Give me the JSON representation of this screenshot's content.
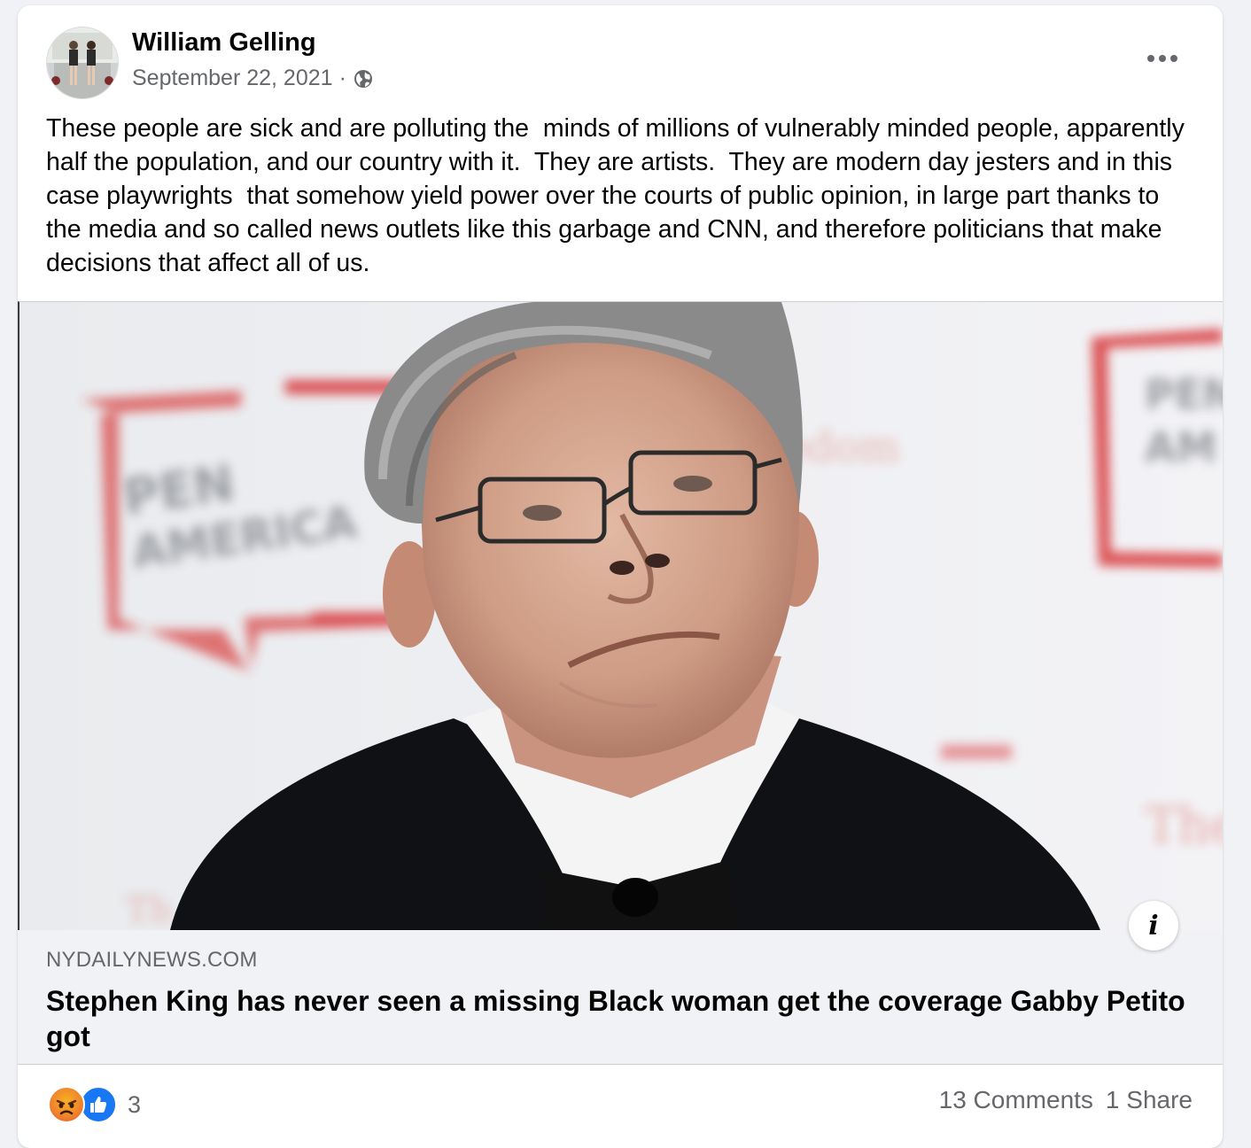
{
  "post": {
    "author": "William Gelling",
    "date": "September 22, 2021",
    "separator": "·",
    "privacy_icon": "globe-icon",
    "body": "These people are sick and are polluting the  minds of millions of vulnerably minded people, apparently half the population, and our country with it.  They are artists.  They are modern day jesters and in this case playwrights  that somehow yield power over the courts of public opinion, in large part thanks to the media and so called news outlets like this garbage and CNN, and therefore politicians that make decisions that affect all of us."
  },
  "link_preview": {
    "domain": "NYDAILYNEWS.COM",
    "headline": "Stephen King has never seen a missing Black woman get the coverage Gabby Petito got",
    "info_label": "i"
  },
  "engagement": {
    "reaction_icons": [
      "angry-reaction-icon",
      "like-reaction-icon"
    ],
    "reaction_count": "3",
    "comments": "13 Comments",
    "shares": "1 Share"
  },
  "colors": {
    "secondary_text": "#65676b",
    "like_blue": "#1877f2",
    "caption_bg": "#f0f2f5",
    "backdrop_red": "#d8383a"
  }
}
